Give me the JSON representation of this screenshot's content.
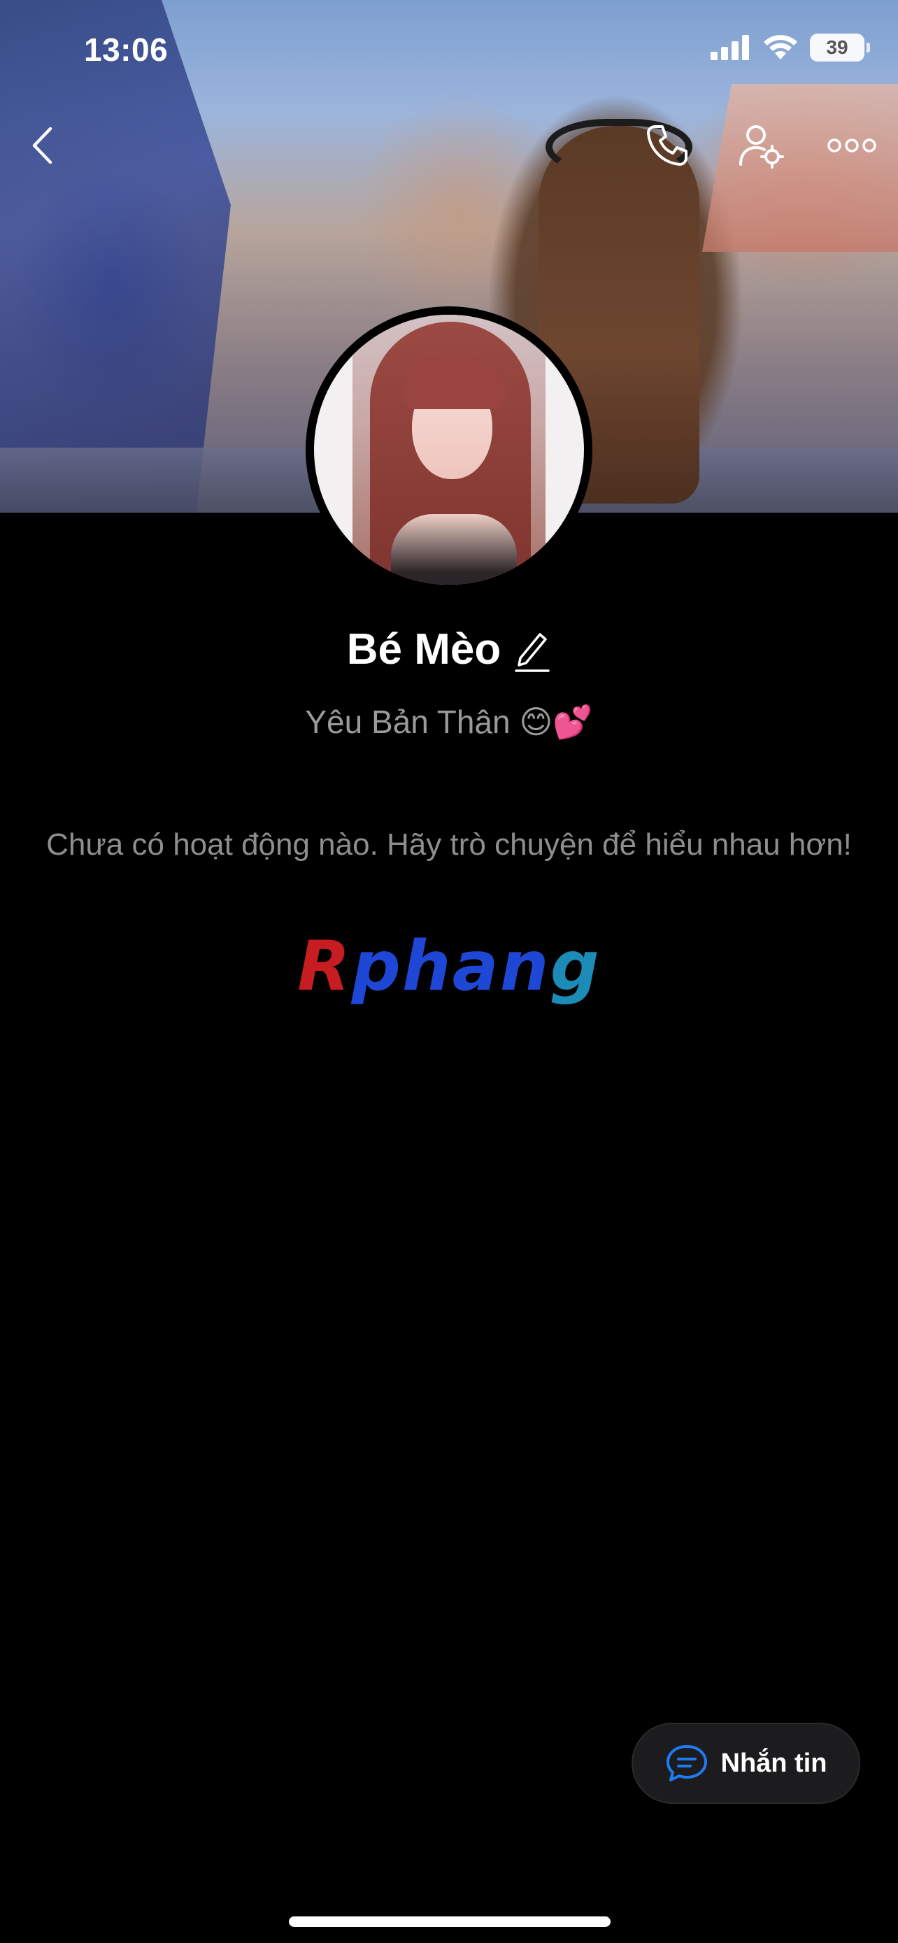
{
  "status_bar": {
    "time": "13:06",
    "battery": "39",
    "signal_icon": "cellular-signal-icon",
    "wifi_icon": "wifi-icon"
  },
  "top_nav": {
    "back_icon": "chevron-left-icon",
    "call_icon": "phone-icon",
    "settings_icon": "user-settings-icon",
    "more_icon": "more-dots-icon"
  },
  "profile": {
    "name": "Bé Mèo",
    "bio_text": "Yêu Bản Thân",
    "bio_emoji": "😊💕",
    "edit_icon": "pencil-edit-icon"
  },
  "activity": {
    "empty_message": "Chưa có hoạt động nào. Hãy trò chuyện để hiểu nhau hơn!"
  },
  "watermark": {
    "part1": "R",
    "part2": "phan",
    "part3": "g"
  },
  "message_button": {
    "label": "Nhắn tin",
    "icon": "chat-bubble-icon",
    "accent_color": "#1e7cf2"
  }
}
